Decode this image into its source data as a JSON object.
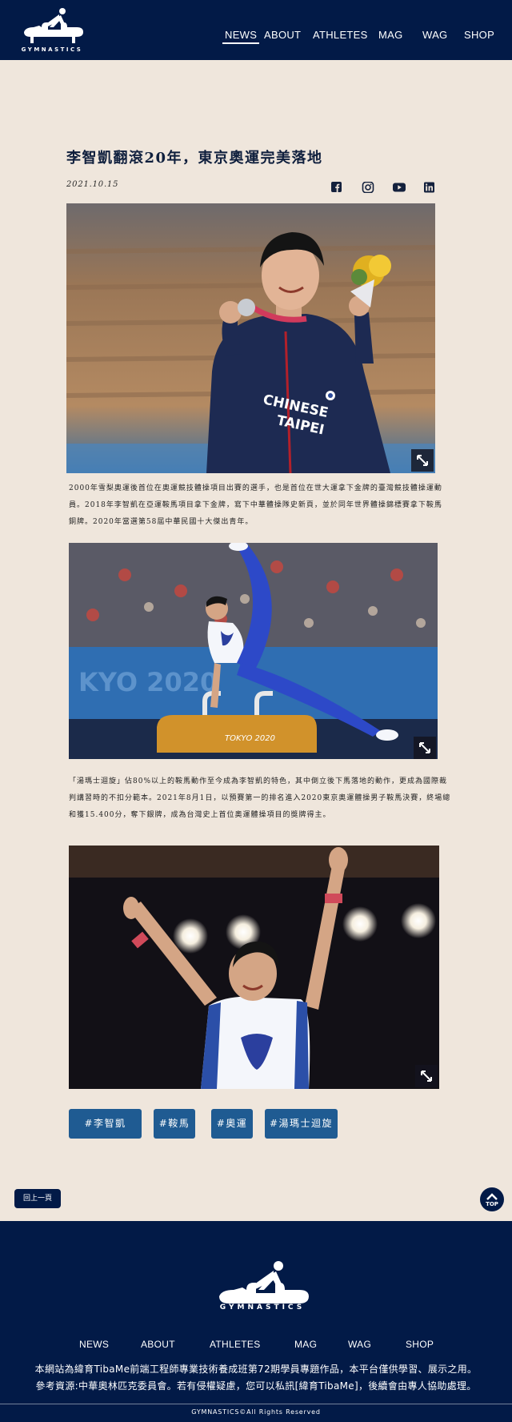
{
  "header": {
    "logo_text": "GYMNASTICS",
    "nav": [
      "NEWS",
      "ABOUT",
      "ATHLETES",
      "MAG",
      "WAG",
      "SHOP"
    ]
  },
  "article": {
    "title": "李智凱翻滾20年，東京奧運完美落地",
    "date": "2021.10.15",
    "social_icons": [
      "facebook-icon",
      "instagram-icon",
      "youtube-icon",
      "linkedin-icon"
    ],
    "paragraph_1": [
      "2000年雪梨奧運後首位在奧運競技體操項目出賽的選手，也是首位在世大運拿下金牌的臺灣競技體操運動",
      "員。2018年李智凱在亞運鞍馬項目拿下金牌，寫下中華體操隊史新頁，並於同年世界體操錦標賽拿下鞍馬",
      "銅牌。2020年當選第58屆中華民國十大傑出青年。"
    ],
    "paragraph_2": [
      "「湯瑪士迴旋」佔80%以上的鞍馬動作至今成為李智凱的特色，其中倒立後下馬落地的動作，更成為國際裁",
      "判講習時的不扣分範本。2021年8月1日，以預賽第一的排名進入2020東京奧運體操男子鞍馬決賽，終場總",
      "和獲15.400分，奪下銀牌，成為台灣史上首位奧運體操項目的獎牌得主。"
    ],
    "tags": [
      "#李智凱",
      "#鞍馬",
      "#奧運",
      "#湯瑪士迴旋"
    ],
    "back_button": "回上一頁",
    "top_button": "TOP"
  },
  "photos": {
    "photo_2_sign": "TOKYO 2020",
    "jersey_text": [
      "CHINESE",
      "TAIPEI"
    ]
  },
  "footer": {
    "logo_text": "GYMNASTICS",
    "nav": [
      "NEWS",
      "ABOUT",
      "ATHLETES",
      "MAG",
      "WAG",
      "SHOP"
    ],
    "disclaimer": "本網站為緯育TibaMe前端工程師專業技術養成班第72期學員專題作品，本平台僅供學習、展示之用。",
    "reference": "參考資源:中華奧林匹克委員會。若有侵權疑慮，您可以私訊[緯育TibaMe]，後續會由專人協助處理。",
    "copyright": "GYMNASTICS©All Rights Reserved"
  },
  "colors": {
    "navy": "#021a47",
    "background": "#efe6dc",
    "tag_blue": "#1f5b92"
  }
}
